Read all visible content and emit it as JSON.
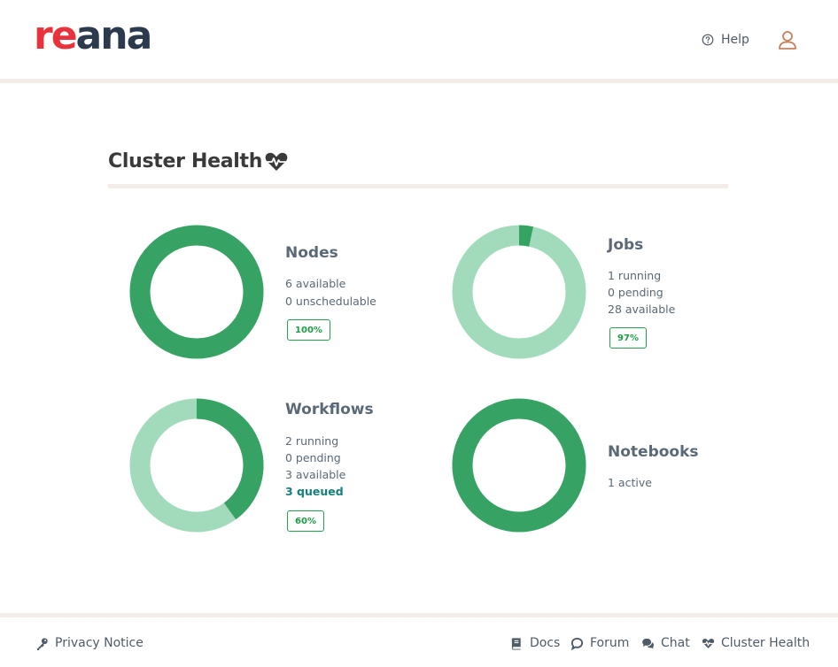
{
  "header": {
    "logo": {
      "part1": "re",
      "part2": "ana"
    },
    "help_label": "Help",
    "icons": {
      "help": "question-circle-icon",
      "user": "user-icon"
    }
  },
  "page": {
    "title": "Cluster Health",
    "title_icon": "heart-pulse-icon"
  },
  "colors": {
    "primary_green": "#36a264",
    "light_green": "#a2dbbc",
    "badge_green": "#22a24d",
    "queued_teal": "#12807e",
    "logo_red": "#e8323c",
    "logo_navy": "#2c3a4d",
    "rule": "#f4ece8"
  },
  "cards": {
    "nodes": {
      "title": "Nodes",
      "stats": [
        "6 available",
        "0 unschedulable"
      ],
      "badge": "100%",
      "filled_fraction": 1.0
    },
    "jobs": {
      "title": "Jobs",
      "stats": [
        "1 running",
        "0 pending",
        "28 available"
      ],
      "badge": "97%",
      "filled_fraction": 0.034
    },
    "workflows": {
      "title": "Workflows",
      "stats": [
        "2 running",
        "0 pending",
        "3 available"
      ],
      "queued": "3 queued",
      "badge": "60%",
      "filled_fraction": 0.4
    },
    "notebooks": {
      "title": "Notebooks",
      "stats": [
        "1 active"
      ],
      "filled_fraction": 1.0
    }
  },
  "footer": {
    "privacy": "Privacy Notice",
    "docs": "Docs",
    "forum": "Forum",
    "chat": "Chat",
    "cluster_health": "Cluster Health",
    "icons": [
      "key-icon",
      "book-icon",
      "speech-bubble-icon",
      "chat-bubbles-icon",
      "heart-pulse-icon"
    ]
  }
}
